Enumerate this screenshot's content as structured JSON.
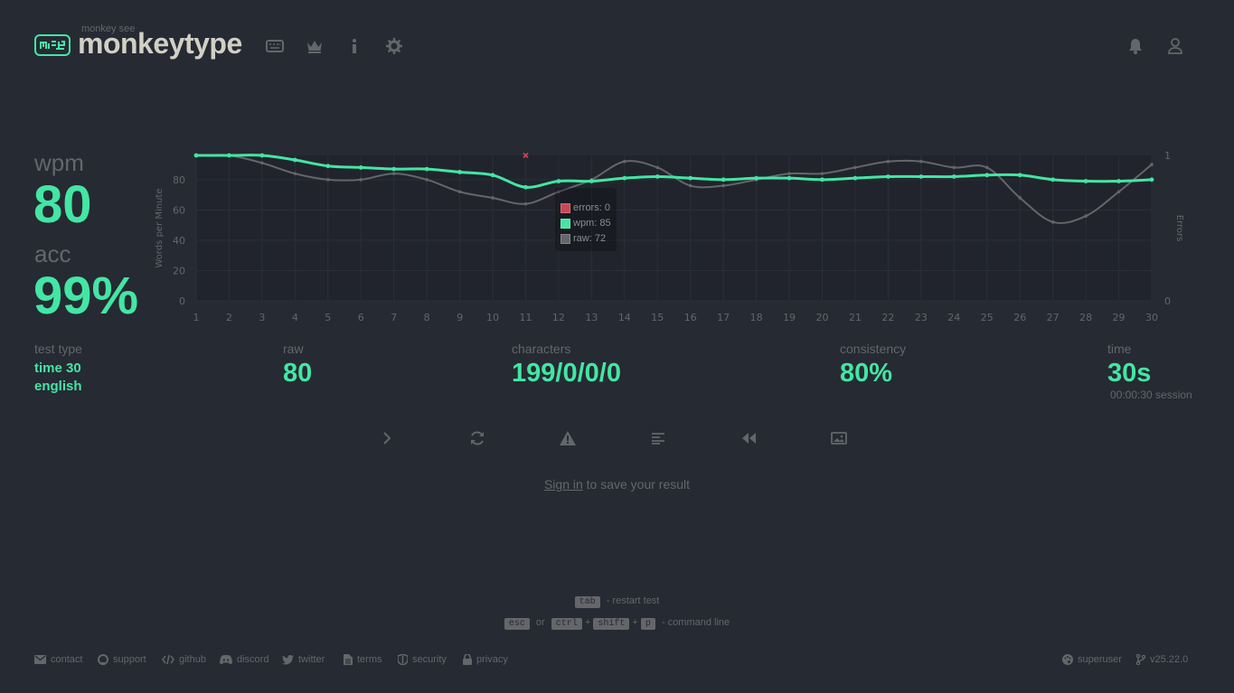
{
  "header": {
    "logo_sub": "monkey see",
    "logo_text": "monkeytype",
    "nav": [
      "keyboard-icon",
      "crown-icon",
      "info-icon",
      "gear-icon"
    ],
    "right": [
      "bell-icon",
      "user-icon"
    ]
  },
  "stats": {
    "wpm_label": "wpm",
    "wpm": "80",
    "acc_label": "acc",
    "acc": "99%",
    "test_type_label": "test type",
    "test_type_line1": "time 30",
    "test_type_line2": "english",
    "raw_label": "raw",
    "raw": "80",
    "characters_label": "characters",
    "characters": "199/0/0/0",
    "consistency_label": "consistency",
    "consistency": "80%",
    "time_label": "time",
    "time": "30s",
    "session": "00:00:30 session"
  },
  "chart_data": {
    "type": "line",
    "x": [
      1,
      2,
      3,
      4,
      5,
      6,
      7,
      8,
      9,
      10,
      11,
      12,
      13,
      14,
      15,
      16,
      17,
      18,
      19,
      20,
      21,
      22,
      23,
      24,
      25,
      26,
      27,
      28,
      29,
      30
    ],
    "series": [
      {
        "name": "wpm",
        "color": "#43e6a4",
        "values": [
          96,
          96,
          96,
          93,
          89,
          88,
          87,
          87,
          85,
          83,
          75,
          79,
          79,
          81,
          82,
          81,
          80,
          81,
          81,
          80,
          81,
          82,
          82,
          82,
          83,
          83,
          80,
          79,
          79,
          80
        ]
      },
      {
        "name": "raw",
        "color": "#646669",
        "values": [
          96,
          96,
          91,
          84,
          80,
          80,
          84,
          80,
          72,
          68,
          64,
          72,
          80,
          92,
          88,
          76,
          76,
          80,
          84,
          84,
          88,
          92,
          92,
          88,
          88,
          68,
          52,
          56,
          72,
          90
        ]
      },
      {
        "name": "errors",
        "color": "#ca4754",
        "points": [
          [
            11,
            1
          ]
        ]
      }
    ],
    "ylabel": "Words per Minute",
    "y2label": "Errors",
    "yticks": [
      "0",
      "20",
      "40",
      "60",
      "80"
    ],
    "y2ticks": [
      "0",
      "1"
    ],
    "ylim": [
      0,
      96
    ],
    "y2lim": [
      0,
      1
    ],
    "xlim": [
      1,
      30
    ],
    "grid": true,
    "tooltip": {
      "errors": "errors: 0",
      "wpm": "wpm: 85",
      "raw": "raw: 72"
    }
  },
  "actions": [
    "next-test-icon",
    "restart-icon",
    "report-icon",
    "words-history-icon",
    "replay-icon",
    "screenshot-icon"
  ],
  "signin": {
    "link": "Sign in",
    "text": " to save your result"
  },
  "hints": {
    "tab": "tab",
    "restart": "- restart test",
    "esc": "esc",
    "or": "or",
    "ctrl": "ctrl",
    "plus1": "+",
    "shift": "shift",
    "plus2": "+",
    "p": "p",
    "command": "- command line"
  },
  "footer": {
    "contact": "contact",
    "support": "support",
    "github": "github",
    "discord": "discord",
    "twitter": "twitter",
    "terms": "terms",
    "security": "security",
    "privacy": "privacy",
    "theme": "superuser",
    "version": "v25.22.0"
  }
}
